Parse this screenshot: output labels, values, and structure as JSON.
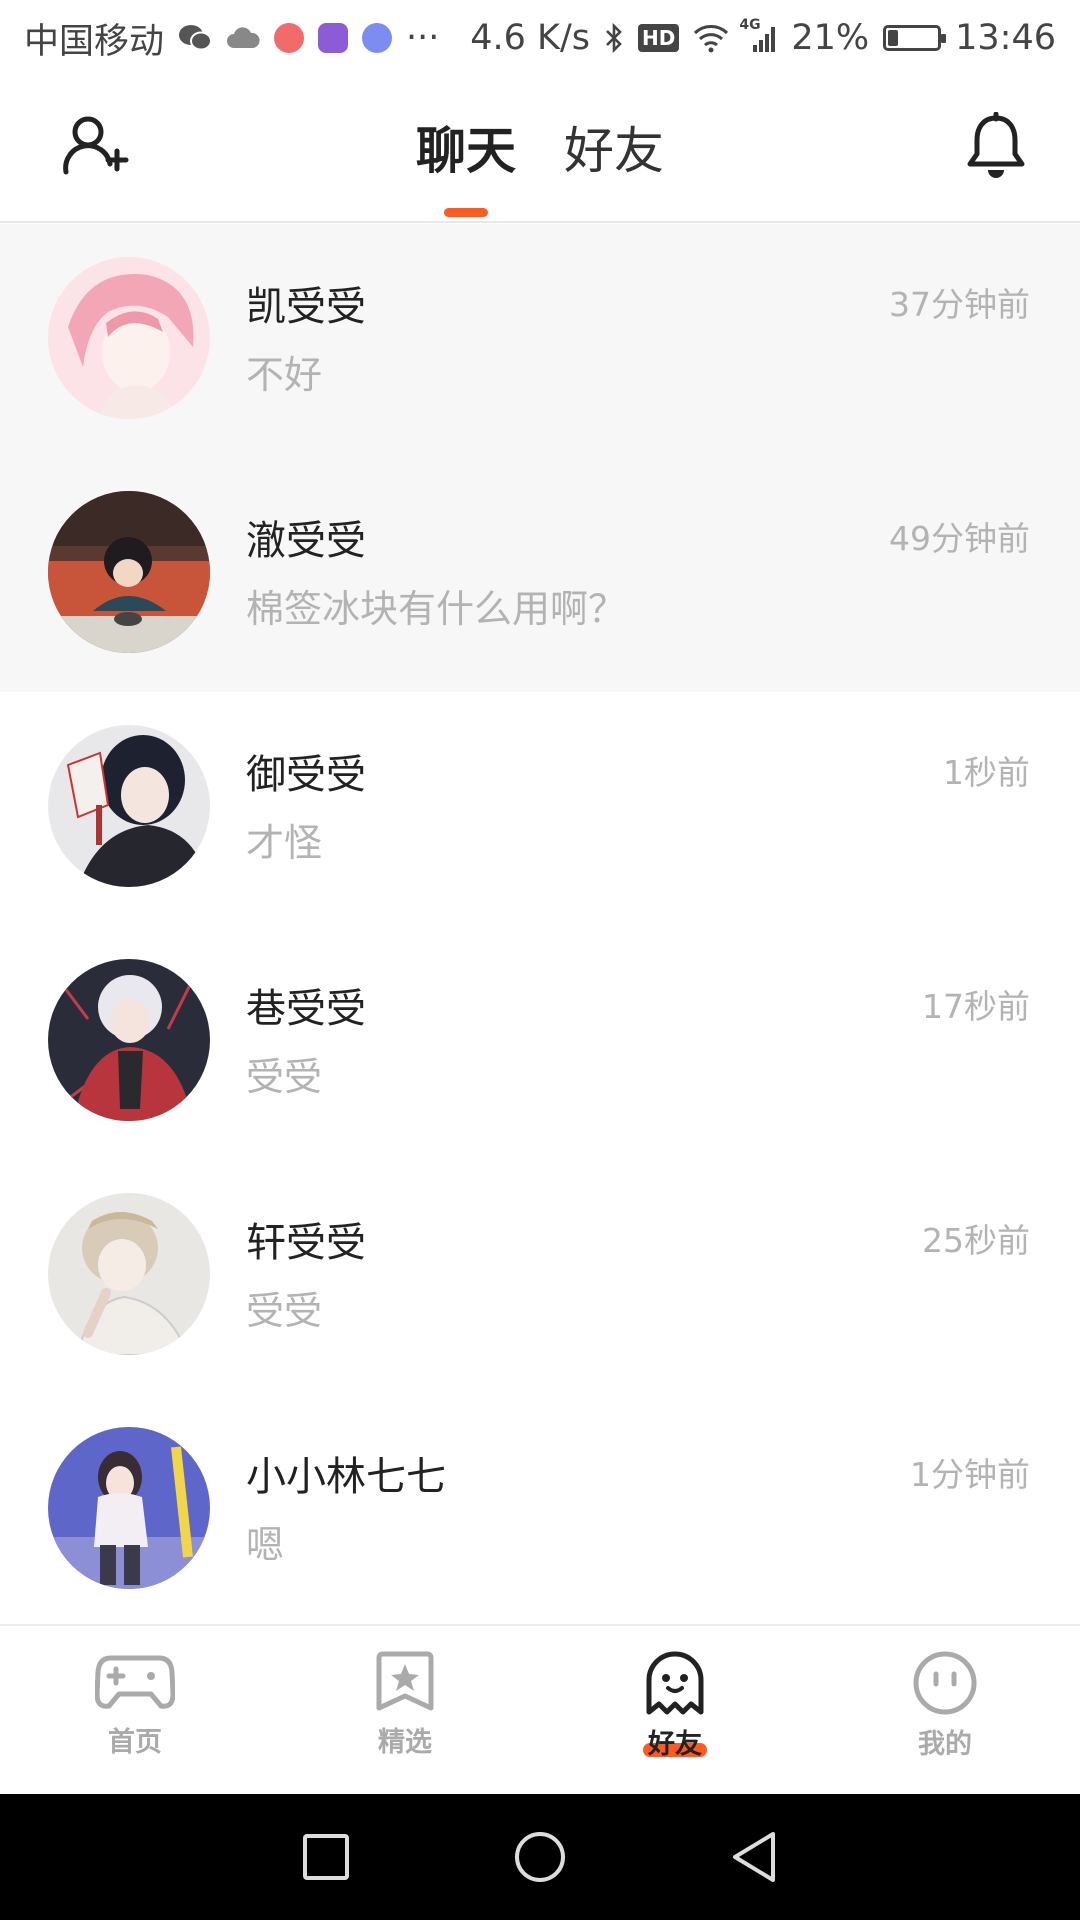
{
  "status_bar": {
    "carrier": "中国移动",
    "more": "···",
    "net_speed": "4.6 K/s",
    "hd": "HD",
    "network": "4G",
    "battery_pct": "21%",
    "battery_level": 0.21,
    "time": "13:46"
  },
  "header": {
    "tabs": [
      {
        "label": "聊天",
        "active": true
      },
      {
        "label": "好友",
        "active": false
      }
    ]
  },
  "colors": {
    "accent": "#ff5a1f",
    "text": "#222222",
    "muted": "#b3b3b3",
    "pinned_bg": "#f7f7f7"
  },
  "chats": [
    {
      "name": "凯受受",
      "preview": "不好",
      "time": "37分钟前",
      "pinned": true
    },
    {
      "name": "澈受受",
      "preview": "棉签冰块有什么用啊？",
      "time": "49分钟前",
      "pinned": true
    },
    {
      "name": "御受受",
      "preview": "才怪",
      "time": "1秒前",
      "pinned": false
    },
    {
      "name": "巷受受",
      "preview": "受受",
      "time": "17秒前",
      "pinned": false
    },
    {
      "name": "轩受受",
      "preview": "受受",
      "time": "25秒前",
      "pinned": false
    },
    {
      "name": "小小林七七",
      "preview": "嗯",
      "time": "1分钟前",
      "pinned": false
    }
  ],
  "bottom_nav": [
    {
      "label": "首页",
      "icon": "gamepad-icon",
      "active": false
    },
    {
      "label": "精选",
      "icon": "star-bookmark-icon",
      "active": false
    },
    {
      "label": "好友",
      "icon": "ghost-icon",
      "active": true
    },
    {
      "label": "我的",
      "icon": "smiley-icon",
      "active": false
    }
  ]
}
